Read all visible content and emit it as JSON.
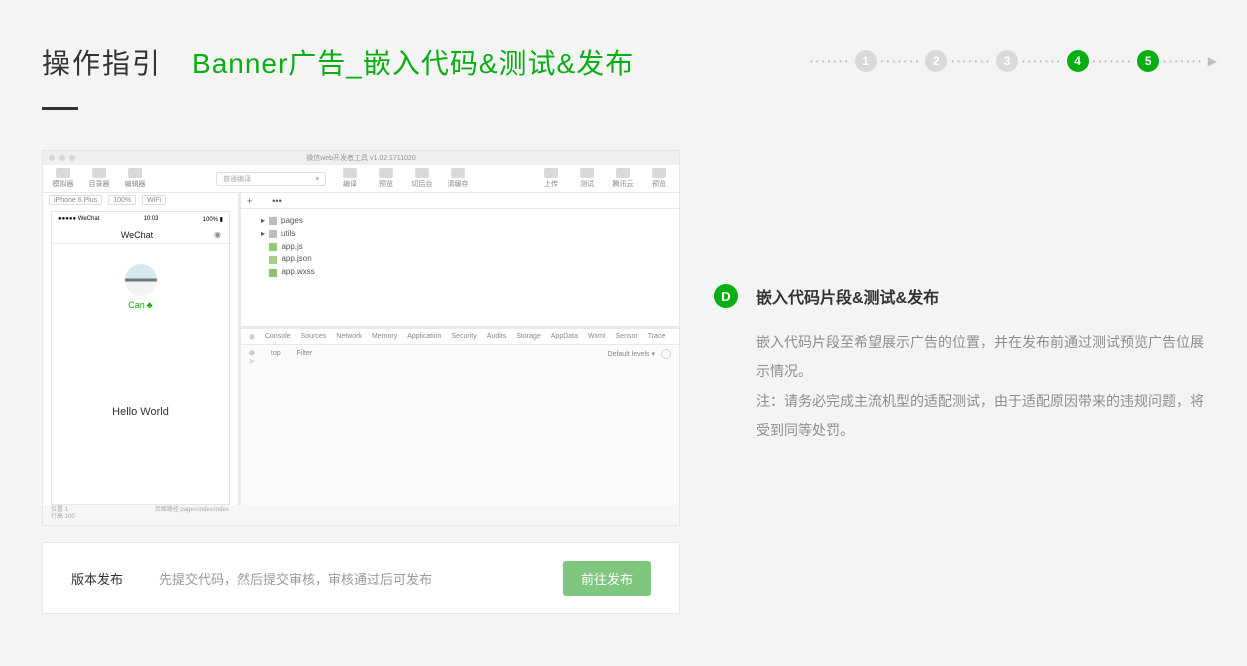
{
  "header": {
    "guide_label": "操作指引",
    "page_title": "Banner广告_嵌入代码&测试&发布"
  },
  "stepper": {
    "steps": [
      "1",
      "2",
      "3",
      "4",
      "5"
    ],
    "active": [
      false,
      false,
      false,
      true,
      true
    ],
    "s1": "1",
    "s2": "2",
    "s3": "3",
    "s4": "4",
    "s5": "5"
  },
  "ide": {
    "window_title": "微信web开发者工具 v1.02.1711020",
    "toolbar": {
      "btn1": "模拟器",
      "btn2": "目录器",
      "btn3": "编辑器",
      "search_placeholder": "普通编译",
      "right": [
        "编译",
        "预览",
        "切后台",
        "清缓存",
        "上传",
        "测试",
        "腾讯云",
        "预览"
      ]
    },
    "sim": {
      "device": "iPhone 6 Plus",
      "zoom": "100%",
      "net": "WiFi",
      "carrier": "●●●●● WeChat",
      "time": "10:03",
      "battery": "100%",
      "nav_title": "WeChat",
      "username": "Can",
      "hello": "Hello World"
    },
    "filebar": {
      "plus": "+",
      "dots": "•••"
    },
    "tree": {
      "root1": "pages",
      "root2": "utils",
      "f1": "app.js",
      "f2": "app.json",
      "f3": "app.wxss"
    },
    "devtools": {
      "tabs": [
        "Console",
        "Sources",
        "Network",
        "Memory",
        "Application",
        "Security",
        "Audits",
        "Storage",
        "AppData",
        "Wxml",
        "Sensor",
        "Trace"
      ],
      "t0": "Console",
      "t1": "Sources",
      "t2": "Network",
      "t3": "Memory",
      "t4": "Application",
      "t5": "Security",
      "t6": "Audits",
      "t7": "Storage",
      "t8": "AppData",
      "t9": "Wxml",
      "t10": "Sensor",
      "t11": "Trace",
      "top": "top",
      "filter": "Filter",
      "levels": "Default levels ▾",
      "caret": ">"
    },
    "footer": {
      "l1": "位置 1",
      "l2": "行高 100",
      "r1": "页面路径 pages/index/index"
    }
  },
  "explain": {
    "badge": "D",
    "title": "嵌入代码片段&测试&发布",
    "p1": "嵌入代码片段至希望展示广告的位置，并在发布前通过测试预览广告位展示情况。",
    "p2": "注：请务必完成主流机型的适配测试，由于适配原因带来的违规问题，将受到同等处罚。"
  },
  "publish": {
    "label": "版本发布",
    "desc": "先提交代码，然后提交审核，审核通过后可发布",
    "button": "前往发布"
  }
}
